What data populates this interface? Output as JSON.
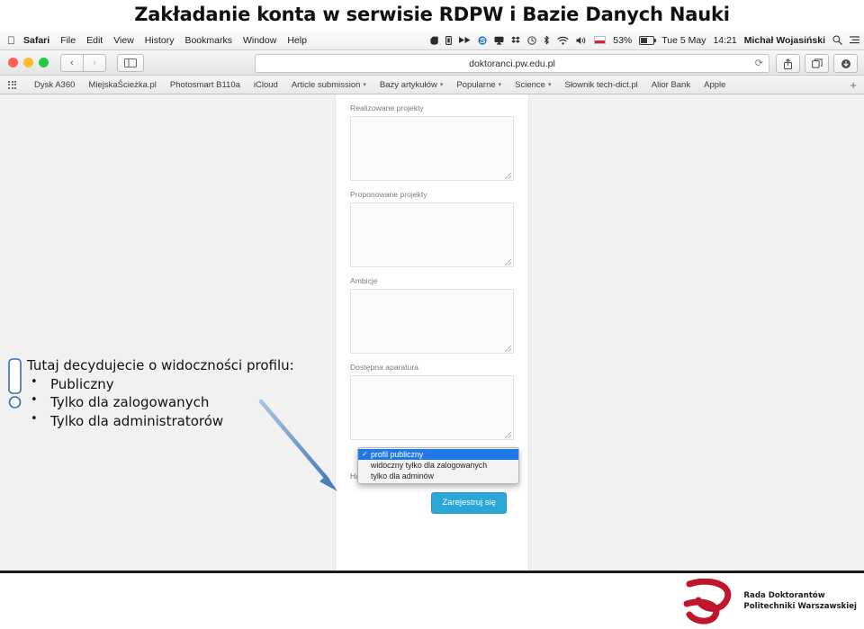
{
  "slide": {
    "title": "Zakładanie konta w serwisie RDPW i Bazie Danych Nauki"
  },
  "menubar": {
    "apple": "",
    "items": [
      {
        "label": "Safari",
        "bold": true
      },
      {
        "label": "File",
        "bold": false
      },
      {
        "label": "Edit",
        "bold": false
      },
      {
        "label": "View",
        "bold": false
      },
      {
        "label": "History",
        "bold": false
      },
      {
        "label": "Bookmarks",
        "bold": false
      },
      {
        "label": "Window",
        "bold": false
      },
      {
        "label": "Help",
        "bold": false
      }
    ],
    "status_icons": [
      "evernote-icon",
      "1password-icon",
      "fast-forward-icon",
      "skype-icon",
      "airplay-icon",
      "dropbox-icon",
      "clock-icon",
      "bluetooth-icon",
      "wifi-icon",
      "volume-icon"
    ],
    "input_flag": "polish-flag-icon",
    "battery_percent": "53%",
    "date": "Tue 5 May",
    "time": "14:21",
    "user": "Michał Wojasiński",
    "search_icon": "search-icon",
    "notification_icon": "notification-center-icon"
  },
  "browser": {
    "back_label": "‹",
    "forward_label": "›",
    "sidebar_icon": "sidebar-icon",
    "url": "doktoranci.pw.edu.pl",
    "reload_glyph": "⟳",
    "share_icon": "share-icon",
    "tabs_icon": "show-tabs-icon",
    "downloads_icon": "downloads-icon",
    "bookmarks": [
      {
        "label": "Dysk A360",
        "menu": false
      },
      {
        "label": "MiejskaŚcieżka.pl",
        "menu": false
      },
      {
        "label": "Photosmart B110a",
        "menu": false
      },
      {
        "label": "iCloud",
        "menu": false
      },
      {
        "label": "Article submission",
        "menu": true
      },
      {
        "label": "Bazy artykułów",
        "menu": true
      },
      {
        "label": "Popularne",
        "menu": true
      },
      {
        "label": "Science",
        "menu": true
      },
      {
        "label": "Słownik tech-dict.pl",
        "menu": false
      },
      {
        "label": "Alior Bank",
        "menu": false
      },
      {
        "label": "Apple",
        "menu": false
      }
    ],
    "add_bookmark_glyph": "+",
    "apps_grid_icon": "apps-grid-icon"
  },
  "form": {
    "fields": [
      {
        "label": "Realizowane projekty",
        "value": ""
      },
      {
        "label": "Proponowane projekty",
        "value": ""
      },
      {
        "label": "Ambicje",
        "value": ""
      },
      {
        "label": "Dostępna aparatura",
        "value": ""
      }
    ],
    "visibility_select": {
      "selected": "profil publiczny",
      "check_glyph": "✓",
      "options": [
        "profil publiczny",
        "widoczny tylko dla zalogowanych",
        "tylko dla adminów"
      ]
    },
    "helper_text": "Hasło zostanie wysłane e-mailem.",
    "submit_label": "Zarejestruj się",
    "submit_color": "#2ba6d8"
  },
  "annotation": {
    "icon": "exclamation-callout-icon",
    "arrow": "arrow-pointing-to-dropdown",
    "accent_color": "#4a7ebb",
    "lines": [
      {
        "text": "Tutaj decydujecie o widoczności profilu:",
        "bullet": false
      },
      {
        "text": "Publiczny",
        "bullet": true
      },
      {
        "text": "Tylko dla zalogowanych",
        "bullet": true
      },
      {
        "text": "Tylko dla administratorów",
        "bullet": true
      }
    ]
  },
  "footer_logo": {
    "mark": "rdpw-swirl-logo",
    "color": "#c0152b",
    "line1": "Rada Doktorantów",
    "line2": "Politechniki Warszawskiej"
  }
}
